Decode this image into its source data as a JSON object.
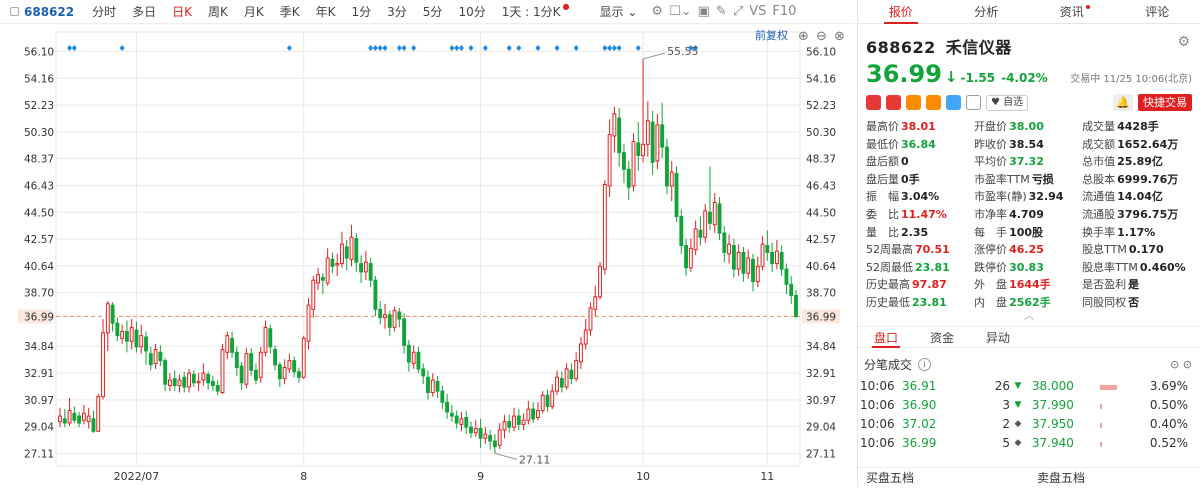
{
  "toolbar": {
    "code": "688622",
    "periods": [
      "分时",
      "多日",
      "日K",
      "周K",
      "月K",
      "季K",
      "年K",
      "1分",
      "3分",
      "5分",
      "10分",
      "1天 : 1分K"
    ],
    "active_period": "日K",
    "display_label": "显示",
    "vs_label": "VS",
    "f10_label": "F10"
  },
  "chart_data": {
    "type": "candlestick",
    "y_ticks": [
      "56.10",
      "54.16",
      "52.23",
      "50.30",
      "48.37",
      "46.43",
      "44.50",
      "42.57",
      "40.64",
      "38.70",
      "36.99",
      "34.84",
      "32.91",
      "30.97",
      "29.04",
      "27.11"
    ],
    "ylim": [
      26.2,
      57.5
    ],
    "x_ticks": [
      {
        "label": "2022/07",
        "index": 16
      },
      {
        "label": "8",
        "index": 51
      },
      {
        "label": "9",
        "index": 88
      },
      {
        "label": "10",
        "index": 122
      },
      {
        "label": "11",
        "index": 148
      }
    ],
    "current_price": 36.99,
    "high_annotation": {
      "label": "55.55",
      "value": 55.55
    },
    "low_annotation": {
      "label": "27.11",
      "value": 27.11
    },
    "restore_label": "前复权",
    "candles": [
      [
        29.4,
        29.8,
        30.4,
        29.0
      ],
      [
        29.6,
        29.3,
        30.3,
        29.0
      ],
      [
        29.3,
        30.2,
        31.1,
        29.1
      ],
      [
        30.0,
        29.5,
        30.5,
        29.3
      ],
      [
        29.8,
        29.3,
        30.1,
        29.0
      ],
      [
        29.5,
        30.0,
        30.6,
        29.2
      ],
      [
        29.4,
        29.8,
        30.4,
        28.9
      ],
      [
        29.6,
        28.7,
        30.2,
        28.6
      ],
      [
        28.7,
        31.2,
        31.4,
        28.7
      ],
      [
        31.2,
        35.8,
        36.8,
        31.0
      ],
      [
        35.8,
        37.9,
        38.1,
        34.5
      ],
      [
        37.8,
        36.5,
        38.0,
        35.9
      ],
      [
        36.5,
        35.6,
        36.9,
        35.2
      ],
      [
        35.4,
        35.9,
        36.4,
        35.0
      ],
      [
        35.9,
        35.2,
        36.7,
        34.4
      ],
      [
        35.2,
        36.2,
        36.8,
        34.6
      ],
      [
        36.0,
        34.8,
        36.6,
        34.4
      ],
      [
        34.8,
        35.6,
        36.4,
        34.3
      ],
      [
        35.5,
        34.5,
        35.9,
        33.5
      ],
      [
        34.3,
        33.5,
        34.8,
        33.1
      ],
      [
        33.6,
        34.6,
        35.0,
        33.2
      ],
      [
        34.4,
        33.8,
        34.9,
        33.4
      ],
      [
        33.8,
        32.1,
        34.0,
        31.6
      ],
      [
        32.0,
        32.4,
        32.9,
        31.6
      ],
      [
        32.5,
        32.0,
        33.1,
        31.6
      ],
      [
        32.0,
        32.4,
        32.8,
        31.5
      ],
      [
        32.6,
        31.9,
        33.0,
        31.5
      ],
      [
        31.9,
        32.9,
        33.2,
        31.5
      ],
      [
        32.8,
        32.2,
        33.1,
        31.9
      ],
      [
        32.2,
        32.3,
        32.9,
        31.6
      ],
      [
        32.4,
        32.9,
        33.6,
        32.0
      ],
      [
        32.8,
        32.2,
        33.0,
        31.7
      ],
      [
        32.3,
        32.0,
        32.7,
        31.6
      ],
      [
        32.0,
        31.6,
        32.4,
        31.3
      ],
      [
        31.5,
        34.6,
        35.0,
        31.4
      ],
      [
        34.4,
        35.6,
        35.9,
        33.9
      ],
      [
        35.4,
        34.4,
        35.9,
        34.0
      ],
      [
        34.4,
        33.3,
        34.8,
        32.7
      ],
      [
        33.4,
        32.2,
        33.7,
        31.7
      ],
      [
        32.1,
        34.3,
        34.7,
        31.8
      ],
      [
        34.3,
        33.1,
        34.7,
        32.7
      ],
      [
        33.1,
        32.4,
        33.6,
        32.1
      ],
      [
        32.6,
        34.4,
        34.8,
        32.2
      ],
      [
        34.4,
        36.2,
        36.7,
        34.1
      ],
      [
        36.1,
        34.8,
        36.4,
        34.3
      ],
      [
        34.6,
        33.5,
        34.9,
        33.1
      ],
      [
        33.5,
        32.5,
        33.7,
        31.9
      ],
      [
        32.5,
        33.3,
        33.9,
        32.1
      ],
      [
        33.2,
        33.8,
        34.3,
        32.9
      ],
      [
        33.8,
        33.0,
        34.1,
        32.6
      ],
      [
        33.0,
        32.6,
        33.3,
        32.2
      ],
      [
        32.6,
        35.4,
        35.6,
        32.5
      ],
      [
        35.2,
        37.8,
        38.3,
        34.6
      ],
      [
        37.5,
        39.6,
        39.9,
        36.9
      ],
      [
        39.4,
        40.0,
        40.5,
        38.9
      ],
      [
        39.8,
        39.6,
        40.1,
        38.6
      ],
      [
        39.4,
        41.2,
        41.9,
        39.2
      ],
      [
        41.1,
        40.6,
        41.6,
        40.1
      ],
      [
        40.7,
        40.8,
        41.5,
        39.9
      ],
      [
        40.8,
        42.2,
        43.1,
        40.5
      ],
      [
        42.0,
        41.2,
        42.5,
        40.3
      ],
      [
        41.1,
        42.7,
        43.6,
        40.6
      ],
      [
        42.6,
        40.9,
        43.0,
        40.2
      ],
      [
        40.8,
        40.2,
        41.4,
        39.4
      ],
      [
        40.2,
        40.9,
        41.7,
        39.6
      ],
      [
        40.8,
        39.6,
        41.2,
        39.1
      ],
      [
        39.6,
        37.5,
        39.9,
        37.0
      ],
      [
        37.5,
        36.9,
        38.1,
        36.4
      ],
      [
        36.9,
        37.1,
        37.9,
        36.1
      ],
      [
        37.1,
        36.2,
        37.4,
        35.6
      ],
      [
        36.2,
        37.4,
        37.7,
        35.9
      ],
      [
        37.3,
        36.8,
        37.6,
        36.2
      ],
      [
        36.8,
        34.9,
        37.2,
        34.3
      ],
      [
        34.9,
        33.7,
        35.3,
        33.0
      ],
      [
        33.6,
        34.4,
        34.9,
        33.2
      ],
      [
        34.4,
        33.2,
        34.8,
        32.9
      ],
      [
        33.2,
        32.7,
        33.6,
        32.1
      ],
      [
        32.6,
        31.5,
        33.1,
        31.0
      ],
      [
        31.5,
        32.4,
        32.9,
        31.2
      ],
      [
        32.3,
        31.6,
        32.7,
        31.1
      ],
      [
        31.6,
        30.8,
        32.0,
        30.3
      ],
      [
        30.8,
        30.1,
        31.4,
        29.6
      ],
      [
        30.0,
        29.8,
        30.6,
        29.4
      ],
      [
        29.8,
        29.3,
        30.2,
        28.9
      ],
      [
        29.2,
        29.6,
        30.1,
        28.7
      ],
      [
        29.7,
        29.0,
        30.2,
        28.5
      ],
      [
        29.0,
        28.6,
        29.4,
        28.2
      ],
      [
        28.6,
        28.9,
        29.5,
        28.3
      ],
      [
        28.9,
        28.2,
        29.6,
        27.5
      ],
      [
        28.2,
        28.5,
        29.0,
        27.8
      ],
      [
        28.4,
        28.0,
        28.8,
        27.4
      ],
      [
        28.0,
        27.6,
        28.5,
        27.1
      ],
      [
        27.7,
        28.8,
        29.3,
        27.4
      ],
      [
        28.8,
        29.4,
        29.9,
        28.2
      ],
      [
        29.4,
        29.0,
        29.9,
        28.6
      ],
      [
        29.0,
        29.8,
        30.4,
        28.7
      ],
      [
        29.8,
        29.2,
        30.3,
        28.8
      ],
      [
        29.2,
        29.5,
        30.0,
        28.8
      ],
      [
        29.5,
        30.3,
        30.9,
        29.2
      ],
      [
        30.3,
        29.6,
        30.8,
        29.3
      ],
      [
        29.7,
        30.2,
        30.8,
        29.5
      ],
      [
        30.2,
        31.3,
        31.6,
        30.0
      ],
      [
        31.3,
        30.5,
        31.7,
        30.1
      ],
      [
        30.5,
        31.6,
        32.1,
        30.3
      ],
      [
        31.6,
        32.6,
        33.1,
        31.3
      ],
      [
        32.5,
        31.9,
        33.0,
        31.5
      ],
      [
        31.9,
        33.2,
        33.6,
        31.7
      ],
      [
        33.1,
        32.5,
        33.6,
        32.1
      ],
      [
        32.5,
        33.8,
        34.4,
        32.3
      ],
      [
        33.7,
        35.0,
        35.5,
        33.2
      ],
      [
        35.0,
        36.0,
        36.8,
        34.6
      ],
      [
        36.0,
        37.6,
        38.0,
        35.6
      ],
      [
        37.5,
        38.4,
        39.2,
        37.0
      ],
      [
        38.4,
        40.6,
        40.9,
        38.2
      ],
      [
        40.4,
        46.5,
        46.8,
        40.0
      ],
      [
        46.4,
        50.1,
        51.2,
        45.6
      ],
      [
        50.0,
        51.6,
        52.1,
        48.8
      ],
      [
        51.3,
        48.8,
        52.0,
        47.8
      ],
      [
        48.8,
        47.6,
        49.4,
        46.6
      ],
      [
        47.6,
        46.3,
        48.2,
        45.4
      ],
      [
        46.4,
        49.6,
        50.2,
        46.0
      ],
      [
        49.5,
        48.6,
        51.0,
        47.5
      ],
      [
        48.6,
        49.4,
        55.55,
        48.1
      ],
      [
        49.4,
        51.1,
        52.5,
        48.5
      ],
      [
        51.0,
        48.1,
        51.8,
        47.2
      ],
      [
        48.2,
        50.8,
        51.6,
        47.6
      ],
      [
        50.8,
        49.2,
        52.4,
        48.4
      ],
      [
        49.2,
        46.4,
        49.8,
        45.8
      ],
      [
        46.4,
        47.4,
        48.2,
        45.3
      ],
      [
        47.3,
        44.2,
        47.8,
        43.8
      ],
      [
        44.2,
        42.1,
        44.7,
        41.5
      ],
      [
        42.1,
        40.5,
        42.6,
        39.9
      ],
      [
        40.5,
        41.9,
        42.6,
        40.2
      ],
      [
        41.8,
        43.3,
        43.9,
        41.4
      ],
      [
        43.2,
        42.7,
        44.2,
        42.1
      ],
      [
        42.7,
        44.6,
        45.1,
        42.3
      ],
      [
        44.5,
        43.7,
        47.8,
        43.2
      ],
      [
        43.6,
        45.2,
        45.9,
        43.0
      ],
      [
        45.1,
        43.0,
        45.6,
        42.5
      ],
      [
        43.0,
        41.6,
        43.5,
        40.9
      ],
      [
        41.5,
        42.2,
        42.9,
        40.8
      ],
      [
        42.1,
        40.4,
        42.6,
        39.8
      ],
      [
        40.4,
        41.6,
        42.2,
        39.9
      ],
      [
        41.6,
        40.1,
        42.0,
        39.5
      ],
      [
        40.1,
        41.2,
        41.8,
        39.7
      ],
      [
        41.1,
        39.5,
        41.5,
        38.8
      ],
      [
        39.5,
        40.6,
        41.3,
        39.1
      ],
      [
        40.6,
        42.2,
        42.8,
        40.3
      ],
      [
        42.1,
        41.6,
        43.2,
        41.0
      ],
      [
        41.6,
        40.8,
        42.3,
        40.2
      ],
      [
        40.8,
        41.7,
        42.5,
        40.4
      ],
      [
        41.6,
        40.4,
        42.1,
        39.9
      ],
      [
        40.4,
        39.3,
        40.8,
        38.6
      ],
      [
        39.3,
        38.5,
        39.9,
        37.9
      ],
      [
        38.5,
        36.99,
        38.9,
        36.84
      ]
    ],
    "markers": [
      2,
      3,
      13,
      48,
      65,
      66,
      67,
      68,
      71,
      72,
      74,
      82,
      83,
      84,
      86,
      89,
      94,
      96,
      100,
      104,
      108,
      114,
      115,
      116,
      117,
      121,
      132,
      133
    ]
  },
  "header_tabs": {
    "quote": "报价",
    "analysis": "分析",
    "news": "资讯",
    "review": "评论"
  },
  "stock": {
    "code": "688622",
    "name": "禾信仪器",
    "price": "36.99",
    "arrow": "↓",
    "change": "-1.55",
    "pct": "-4.02%",
    "trade_time": "交易中 11/25 10:06(北京)",
    "watch_label": "自选",
    "quick_trade": "快捷交易",
    "bell_icon": "🔔"
  },
  "stats": [
    [
      [
        "最高价",
        "38.01",
        "r"
      ],
      [
        "开盘价",
        "38.00",
        "g"
      ],
      [
        "成交量",
        "4428手",
        ""
      ]
    ],
    [
      [
        "最低价",
        "36.84",
        "g"
      ],
      [
        "昨收价",
        "38.54",
        ""
      ],
      [
        "成交额",
        "1652.64万",
        ""
      ]
    ],
    [
      [
        "盘后额",
        "0",
        ""
      ],
      [
        "平均价",
        "37.32",
        "g"
      ],
      [
        "总市值",
        "25.89亿",
        ""
      ]
    ],
    [
      [
        "盘后量",
        "0手",
        ""
      ],
      [
        "市盈率TTM",
        "亏损",
        ""
      ],
      [
        "总股本",
        "6999.76万",
        ""
      ]
    ],
    [
      [
        "振　幅",
        "3.04%",
        ""
      ],
      [
        "市盈率(静)",
        "32.94",
        ""
      ],
      [
        "流通值",
        "14.04亿",
        ""
      ]
    ],
    [
      [
        "委　比",
        "11.47%",
        "r"
      ],
      [
        "市净率",
        "4.709",
        ""
      ],
      [
        "流通股",
        "3796.75万",
        ""
      ]
    ],
    [
      [
        "量　比",
        "2.35",
        ""
      ],
      [
        "每　手",
        "100股",
        ""
      ],
      [
        "换手率",
        "1.17%",
        ""
      ]
    ],
    [
      [
        "52周最高",
        "70.51",
        "r"
      ],
      [
        "涨停价",
        "46.25",
        "r"
      ],
      [
        "股息TTM",
        "0.170",
        ""
      ]
    ],
    [
      [
        "52周最低",
        "23.81",
        "g"
      ],
      [
        "跌停价",
        "30.83",
        "g"
      ],
      [
        "股息率TTM",
        "0.460%",
        ""
      ]
    ],
    [
      [
        "历史最高",
        "97.87",
        "r"
      ],
      [
        "外　盘",
        "1644手",
        "r"
      ],
      [
        "是否盈利",
        "是",
        ""
      ]
    ],
    [
      [
        "历史最低",
        "23.81",
        "g"
      ],
      [
        "内　盘",
        "2562手",
        "g"
      ],
      [
        "同股同权",
        "否",
        ""
      ]
    ]
  ],
  "subtabs": {
    "panel": "盘口",
    "fund": "资金",
    "abnormal": "异动"
  },
  "ticks_title": "分笔成交",
  "ticks": [
    {
      "time": "10:06",
      "price": "36.91",
      "vol": "26",
      "mark": "▼"
    },
    {
      "time": "10:06",
      "price": "36.90",
      "vol": "3",
      "mark": "▼"
    },
    {
      "time": "10:06",
      "price": "37.02",
      "vol": "2",
      "mark": "◆"
    },
    {
      "time": "10:06",
      "price": "36.99",
      "vol": "5",
      "mark": "◆"
    }
  ],
  "book": [
    {
      "price": "38.000",
      "pct": "3.69%",
      "bar": 0.35
    },
    {
      "price": "37.990",
      "pct": "0.50%",
      "bar": 0.05
    },
    {
      "price": "37.950",
      "pct": "0.40%",
      "bar": 0.04
    },
    {
      "price": "37.940",
      "pct": "0.52%",
      "bar": 0.05
    }
  ],
  "bottom": {
    "buy5": "买盘五档",
    "sell5": "卖盘五档"
  },
  "colors": {
    "up": "#e02020",
    "down": "#12a33a",
    "marker": "#1e88e5",
    "grid": "#e9e9e9"
  }
}
